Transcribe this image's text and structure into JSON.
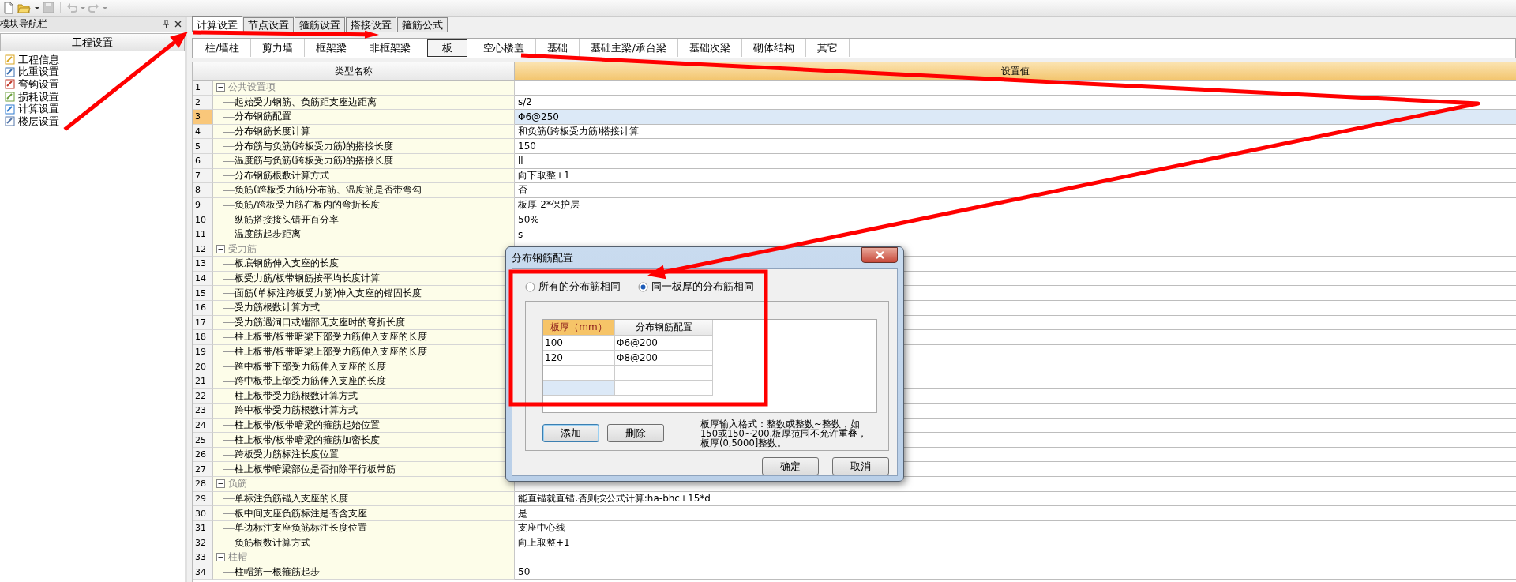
{
  "nav_panel": {
    "title": "模块导航栏",
    "header": "工程设置",
    "items": [
      {
        "label": "工程信息"
      },
      {
        "label": "比重设置"
      },
      {
        "label": "弯钩设置"
      },
      {
        "label": "损耗设置"
      },
      {
        "label": "计算设置"
      },
      {
        "label": "楼层设置"
      }
    ]
  },
  "tabs": [
    {
      "label": "计算设置",
      "selected": true
    },
    {
      "label": "节点设置",
      "selected": false
    },
    {
      "label": "箍筋设置",
      "selected": false
    },
    {
      "label": "搭接设置",
      "selected": false
    },
    {
      "label": "箍筋公式",
      "selected": false
    }
  ],
  "subtabs": [
    {
      "label": "柱/墙柱",
      "selected": false
    },
    {
      "label": "剪力墙",
      "selected": false
    },
    {
      "label": "框架梁",
      "selected": false
    },
    {
      "label": "非框架梁",
      "selected": false
    },
    {
      "label": "板",
      "selected": true
    },
    {
      "label": "空心楼盖",
      "selected": false
    },
    {
      "label": "基础",
      "selected": false
    },
    {
      "label": "基础主梁/承台梁",
      "selected": false
    },
    {
      "label": "基础次梁",
      "selected": false
    },
    {
      "label": "砌体结构",
      "selected": false
    },
    {
      "label": "其它",
      "selected": false
    }
  ],
  "table": {
    "columns": [
      "类型名称",
      "设置值"
    ],
    "rows": [
      {
        "no": "1",
        "kind": "group",
        "name": "公共设置项",
        "expanded": true,
        "selected": false
      },
      {
        "no": "2",
        "kind": "item",
        "name": "起始受力钢筋、负筋距支座边距离",
        "value": "s/2",
        "selected": false
      },
      {
        "no": "3",
        "kind": "item",
        "name": "分布钢筋配置",
        "value": "Φ6@250",
        "selected": true
      },
      {
        "no": "4",
        "kind": "item",
        "name": "分布钢筋长度计算",
        "value": "和负筋(跨板受力筋)搭接计算",
        "selected": false
      },
      {
        "no": "5",
        "kind": "item",
        "name": "分布筋与负筋(跨板受力筋)的搭接长度",
        "value": "150",
        "selected": false
      },
      {
        "no": "6",
        "kind": "item",
        "name": "温度筋与负筋(跨板受力筋)的搭接长度",
        "value": "ll",
        "selected": false
      },
      {
        "no": "7",
        "kind": "item",
        "name": "分布钢筋根数计算方式",
        "value": "向下取整+1",
        "selected": false
      },
      {
        "no": "8",
        "kind": "item",
        "name": "负筋(跨板受力筋)分布筋、温度筋是否带弯勾",
        "value": "否",
        "selected": false
      },
      {
        "no": "9",
        "kind": "item",
        "name": "负筋/跨板受力筋在板内的弯折长度",
        "value": "板厚-2*保护层",
        "selected": false
      },
      {
        "no": "10",
        "kind": "item",
        "name": "纵筋搭接接头错开百分率",
        "value": "50%",
        "selected": false
      },
      {
        "no": "11",
        "kind": "item",
        "name": "温度筋起步距离",
        "value": "s",
        "selected": false
      },
      {
        "no": "12",
        "kind": "group",
        "name": "受力筋",
        "expanded": true,
        "selected": false
      },
      {
        "no": "13",
        "kind": "item",
        "name": "板底钢筋伸入支座的长度",
        "selected": false
      },
      {
        "no": "14",
        "kind": "item",
        "name": "板受力筋/板带钢筋按平均长度计算",
        "selected": false
      },
      {
        "no": "15",
        "kind": "item",
        "name": "面筋(单标注跨板受力筋)伸入支座的锚固长度",
        "selected": false
      },
      {
        "no": "16",
        "kind": "item",
        "name": "受力筋根数计算方式",
        "selected": false
      },
      {
        "no": "17",
        "kind": "item",
        "name": "受力筋遇洞口或端部无支座时的弯折长度",
        "selected": false
      },
      {
        "no": "18",
        "kind": "item",
        "name": "柱上板带/板带暗梁下部受力筋伸入支座的长度",
        "selected": false
      },
      {
        "no": "19",
        "kind": "item",
        "name": "柱上板带/板带暗梁上部受力筋伸入支座的长度",
        "selected": false
      },
      {
        "no": "20",
        "kind": "item",
        "name": "跨中板带下部受力筋伸入支座的长度",
        "selected": false
      },
      {
        "no": "21",
        "kind": "item",
        "name": "跨中板带上部受力筋伸入支座的长度",
        "selected": false
      },
      {
        "no": "22",
        "kind": "item",
        "name": "柱上板带受力筋根数计算方式",
        "selected": false
      },
      {
        "no": "23",
        "kind": "item",
        "name": "跨中板带受力筋根数计算方式",
        "selected": false
      },
      {
        "no": "24",
        "kind": "item",
        "name": "柱上板带/板带暗梁的箍筋起始位置",
        "selected": false
      },
      {
        "no": "25",
        "kind": "item",
        "name": "柱上板带/板带暗梁的箍筋加密长度",
        "selected": false
      },
      {
        "no": "26",
        "kind": "item",
        "name": "跨板受力筋标注长度位置",
        "selected": false
      },
      {
        "no": "27",
        "kind": "item",
        "name": "柱上板带暗梁部位是否扣除平行板带筋",
        "selected": false
      },
      {
        "no": "28",
        "kind": "group",
        "name": "负筋",
        "expanded": true,
        "selected": false
      },
      {
        "no": "29",
        "kind": "item",
        "name": "单标注负筋锚入支座的长度",
        "value": "能直锚就直锚,否则按公式计算:ha-bhc+15*d",
        "selected": false
      },
      {
        "no": "30",
        "kind": "item",
        "name": "板中间支座负筋标注是否含支座",
        "value": "是",
        "selected": false
      },
      {
        "no": "31",
        "kind": "item",
        "name": "单边标注支座负筋标注长度位置",
        "value": "支座中心线",
        "selected": false
      },
      {
        "no": "32",
        "kind": "item",
        "name": "负筋根数计算方式",
        "value": "向上取整+1",
        "selected": false
      },
      {
        "no": "33",
        "kind": "group",
        "name": "柱帽",
        "expanded": true,
        "selected": false
      },
      {
        "no": "34",
        "kind": "item",
        "name": "柱帽第一根箍筋起步",
        "value": "50",
        "selected": false
      }
    ]
  },
  "dialog": {
    "title": "分布钢筋配置",
    "options": [
      {
        "label": "所有的分布筋相同",
        "selected": false
      },
      {
        "label": "同一板厚的分布筋相同",
        "selected": true
      }
    ],
    "grid": {
      "columns": [
        "板厚（mm）",
        "分布钢筋配置"
      ],
      "rows": [
        {
          "cells": [
            "100",
            "Φ6@200"
          ],
          "selected": false
        },
        {
          "cells": [
            "120",
            "Φ8@200"
          ],
          "selected": false
        },
        {
          "selected": false
        },
        {
          "selected": true
        }
      ]
    },
    "add_button": "添加",
    "delete_button": "删除",
    "hint": "板厚输入格式：整数或整数~整数，如150或150~200.板厚范围不允许重叠，板厚(0,5000]整数。",
    "ok_button": "确定",
    "cancel_button": "取消"
  }
}
